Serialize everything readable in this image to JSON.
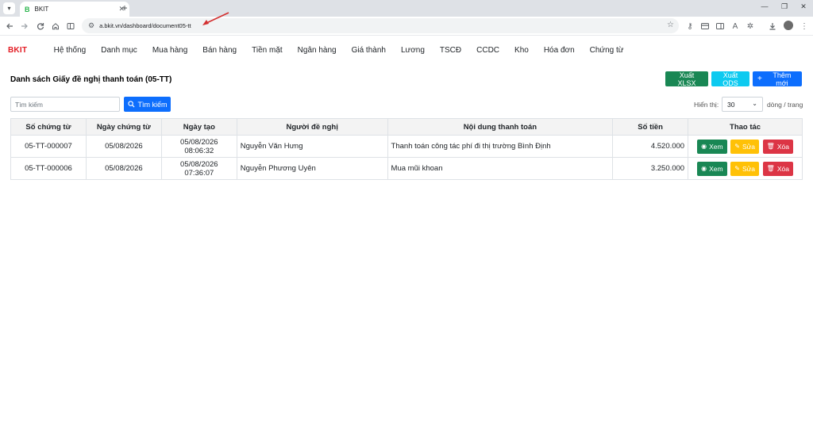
{
  "browser": {
    "tab_title": "BKIT",
    "tab_favicon": "B",
    "url": "a.bkit.vn/dashboard/document05-tt"
  },
  "app": {
    "brand": "BKIT",
    "nav": [
      "Hệ thống",
      "Danh mục",
      "Mua hàng",
      "Bán hàng",
      "Tiền mặt",
      "Ngân hàng",
      "Giá thành",
      "Lương",
      "TSCĐ",
      "CCDC",
      "Kho",
      "Hóa đơn",
      "Chứng từ"
    ]
  },
  "page": {
    "title": "Danh sách Giấy đề nghị thanh toán (05-TT)",
    "export_xlsx_label": "Xuất XLSX",
    "export_ods_label": "Xuất ODS",
    "add_new_label": "Thêm mới"
  },
  "search": {
    "placeholder": "Tìm kiếm",
    "button_label": "Tìm kiếm",
    "show_label": "Hiển thị:",
    "page_size": "30",
    "rows_label": "dòng / trang"
  },
  "table": {
    "columns": [
      "Số chứng từ",
      "Ngày chứng từ",
      "Ngày tạo",
      "Người đề nghị",
      "Nội dung thanh toán",
      "Số tiền",
      "Thao tác"
    ],
    "rows": [
      [
        "05-TT-000007",
        "05/08/2026",
        "05/08/2026 08:06:32",
        "Nguyễn Văn Hưng",
        "Thanh toán công tác phí đi thị trường Bình Định",
        "4.520.000"
      ],
      [
        "05-TT-000006",
        "05/08/2026",
        "05/08/2026 07:36:07",
        "Nguyễn Phương Uyên",
        "Mua mũi khoan",
        "3.250.000"
      ]
    ],
    "action_labels": {
      "view": "Xem",
      "edit": "Sửa",
      "delete": "Xóa"
    }
  },
  "colors": {
    "brand": "#e31b23",
    "success": "#198754",
    "info": "#0dcaf0",
    "primary": "#0d6efd",
    "warning": "#ffc107",
    "danger": "#dc3545",
    "annotation_arrow": "#d32f2f"
  }
}
